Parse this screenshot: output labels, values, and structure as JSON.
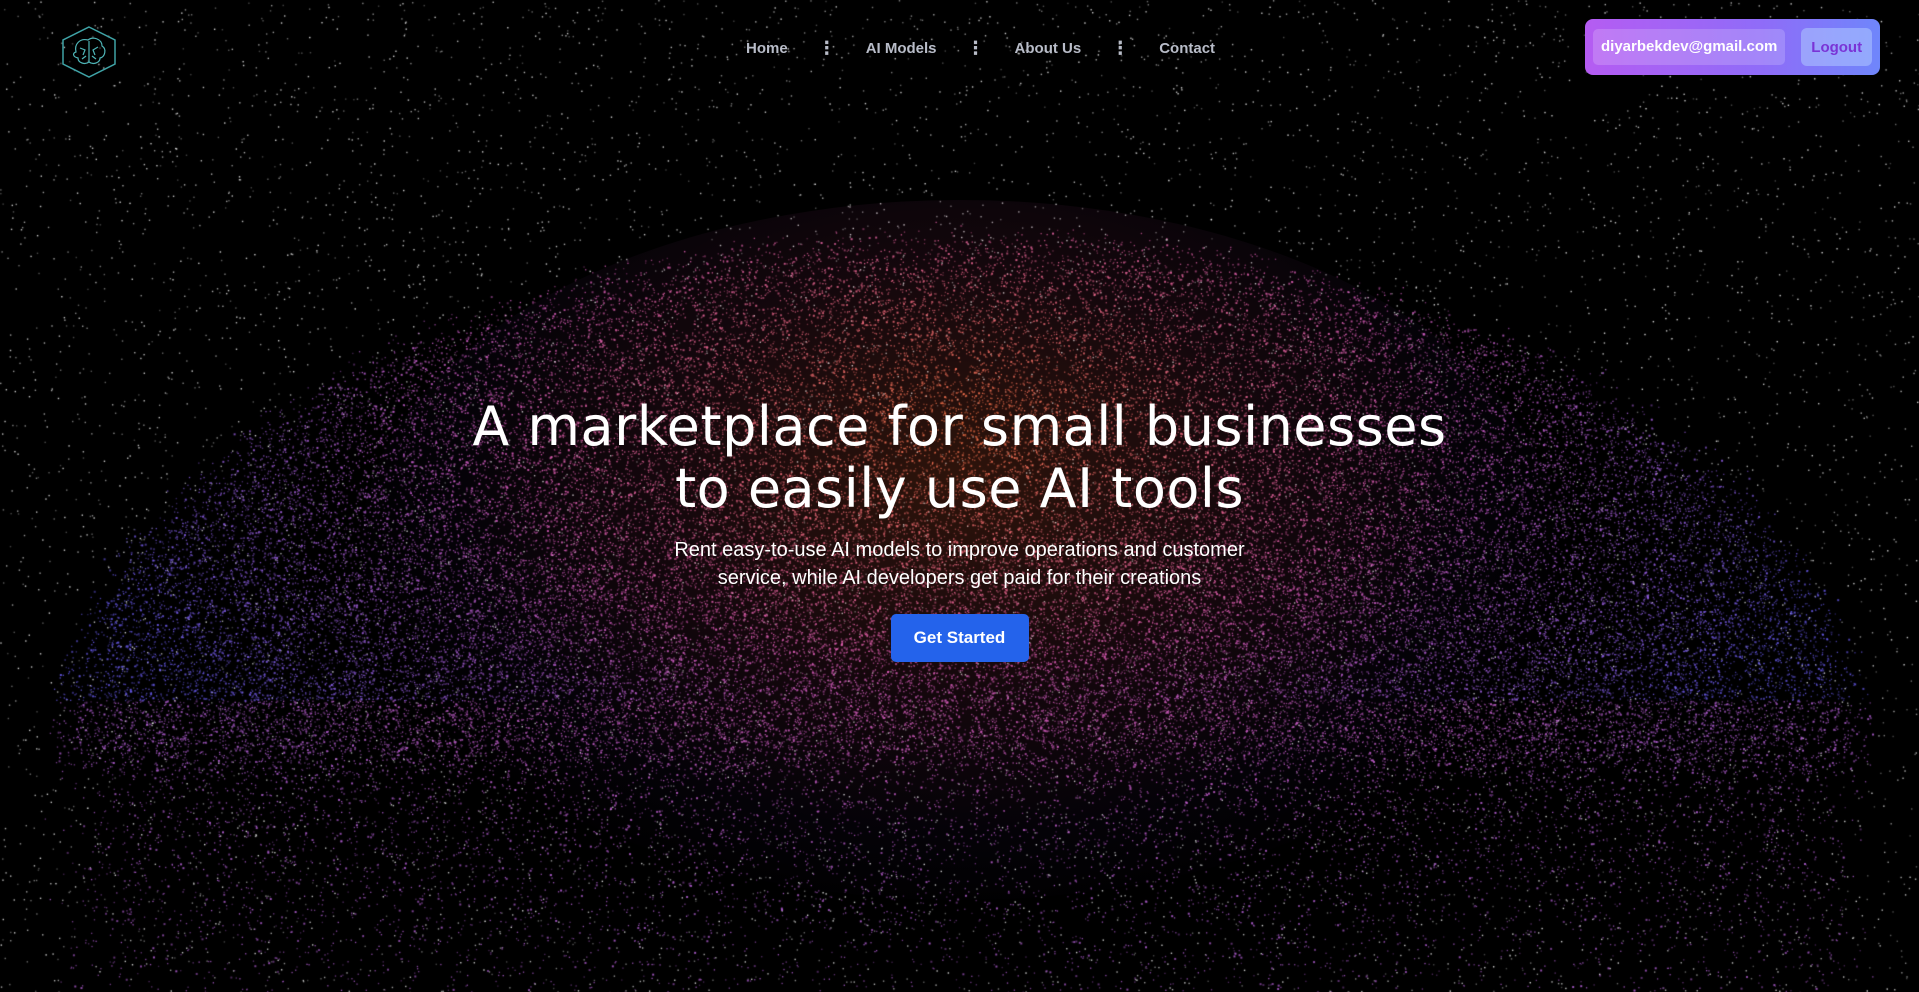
{
  "header": {
    "logo_icon": "brain-hexagon-icon",
    "nav": {
      "home": "Home",
      "ai_models": "AI Models",
      "about_us": "About Us",
      "contact": "Contact"
    },
    "separator_glyph": "⋮",
    "user": {
      "email": "diyarbekdev@gmail.com",
      "logout_label": "Logout"
    }
  },
  "hero": {
    "title_line1": "A marketplace for small businesses",
    "title_line2": "to easily use AI tools",
    "subtitle_line1": "Rent easy-to-use AI models to improve operations and customer",
    "subtitle_line2": "service, while AI developers get paid for their creations",
    "cta_label": "Get Started"
  },
  "theme": {
    "background": "#000000",
    "cta_color": "#2463eb",
    "user_box_gradient": [
      "#b55cf2",
      "#6f86fb"
    ],
    "particle_warm": "#ff7a45",
    "particle_pink": "#e060c0",
    "particle_violet": "#6a5cf0"
  }
}
